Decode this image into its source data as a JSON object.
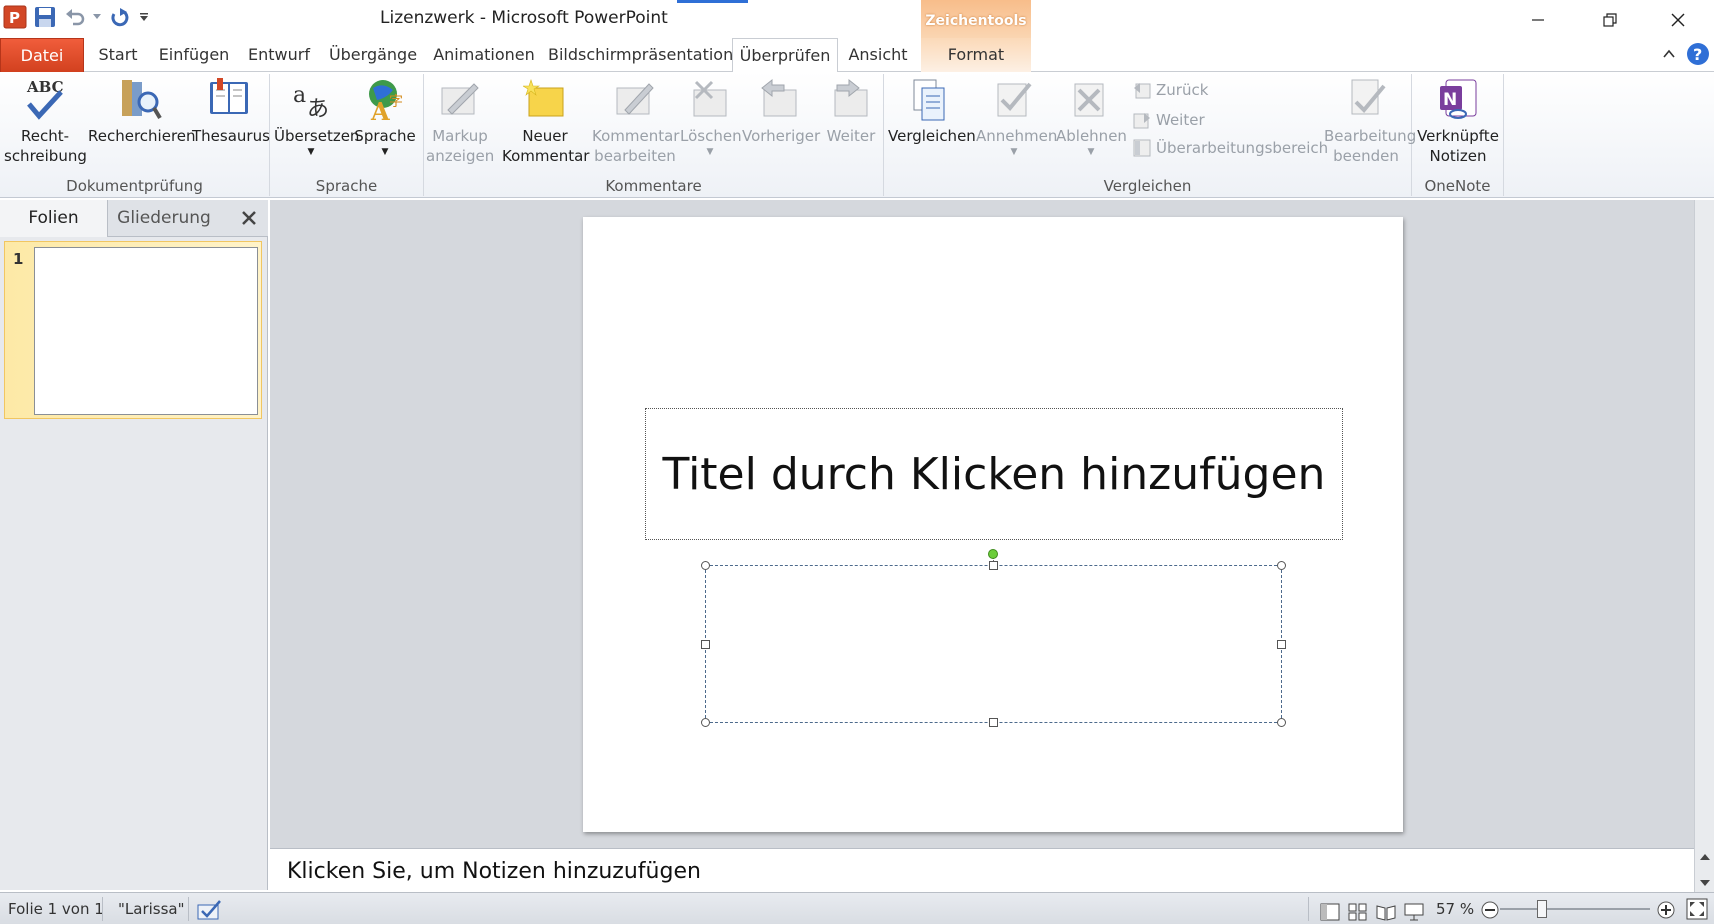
{
  "window": {
    "title": "Lizenzwerk  -  Microsoft PowerPoint",
    "contextual_tab_group": "Zeichentools"
  },
  "tabs": {
    "file": "Datei",
    "items": [
      "Start",
      "Einfügen",
      "Entwurf",
      "Übergänge",
      "Animationen",
      "Bildschirmpräsentation",
      "Überprüfen",
      "Ansicht",
      "Format"
    ],
    "active": "Überprüfen"
  },
  "ribbon": {
    "groups": {
      "dokumentpruefung": {
        "label": "Dokumentprüfung",
        "rechtschreibung_line1": "Recht-",
        "rechtschreibung_line2": "schreibung",
        "recherchieren": "Recherchieren",
        "thesaurus": "Thesaurus"
      },
      "sprache": {
        "label": "Sprache",
        "uebersetzen": "Übersetzen",
        "sprache": "Sprache"
      },
      "kommentare": {
        "label": "Kommentare",
        "markup_line1": "Markup",
        "markup_line2": "anzeigen",
        "neuer_line1": "Neuer",
        "neuer_line2": "Kommentar",
        "kommentar_line1": "Kommentar",
        "kommentar_line2": "bearbeiten",
        "loeschen": "Löschen",
        "vorheriger": "Vorheriger",
        "weiter": "Weiter"
      },
      "vergleichen": {
        "label": "Vergleichen",
        "vergleichen": "Vergleichen",
        "annehmen": "Annehmen",
        "ablehnen": "Ablehnen",
        "zurueck": "Zurück",
        "weiter": "Weiter",
        "ueberarbeitungsbereich": "Überarbeitungsbereich",
        "bearbeitung_line1": "Bearbeitung",
        "bearbeitung_line2": "beenden"
      },
      "onenote": {
        "label": "OneNote",
        "notizen_line1": "Verknüpfte",
        "notizen_line2": "Notizen"
      }
    }
  },
  "left_pane": {
    "tab_folien": "Folien",
    "tab_gliederung": "Gliederung",
    "slide_number": "1"
  },
  "slide": {
    "title_placeholder": "Titel durch Klicken hinzufügen"
  },
  "notes": {
    "placeholder": "Klicken Sie, um Notizen hinzuzufügen"
  },
  "status": {
    "slide_info": "Folie 1 von 1",
    "theme": "\"Larissa\"",
    "zoom": "57 %",
    "zoom_level_percent": 57
  },
  "colors": {
    "file_tab": "#d2411f",
    "contextual": "#f8bd8a",
    "accent_blue": "#2f6fd6"
  }
}
